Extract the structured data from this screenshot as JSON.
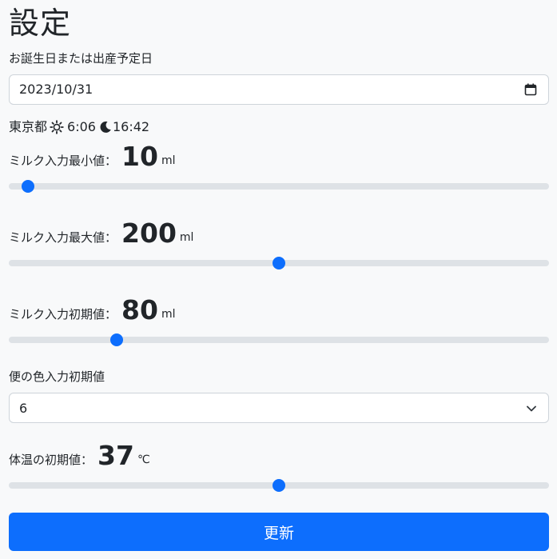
{
  "page": {
    "title": "設定"
  },
  "birth": {
    "label": "お誕生日または出産予定日",
    "value": "2023/10/31",
    "icon": "calendar-icon"
  },
  "sun": {
    "location": "東京都",
    "sunrise": "6:06",
    "sunset": "16:42",
    "sunrise_icon": "sun-icon",
    "sunset_icon": "moon-icon"
  },
  "milk_min": {
    "label": "ミルク入力最小値：",
    "value": "10",
    "unit": "ml",
    "fraction": 0.035
  },
  "milk_max": {
    "label": "ミルク入力最大値：",
    "value": "200",
    "unit": "ml",
    "fraction": 0.5
  },
  "milk_init": {
    "label": "ミルク入力初期値：",
    "value": "80",
    "unit": "ml",
    "fraction": 0.2
  },
  "stool": {
    "label": "便の色入力初期値",
    "value": "6",
    "icon": "chevron-down-icon"
  },
  "temp": {
    "label": "体温の初期値：",
    "value": "37",
    "unit": "℃",
    "fraction": 0.5
  },
  "submit": {
    "label": "更新"
  },
  "colors": {
    "accent": "#0d6efd",
    "track": "#dee2e6",
    "background": "#f8f9fa"
  }
}
